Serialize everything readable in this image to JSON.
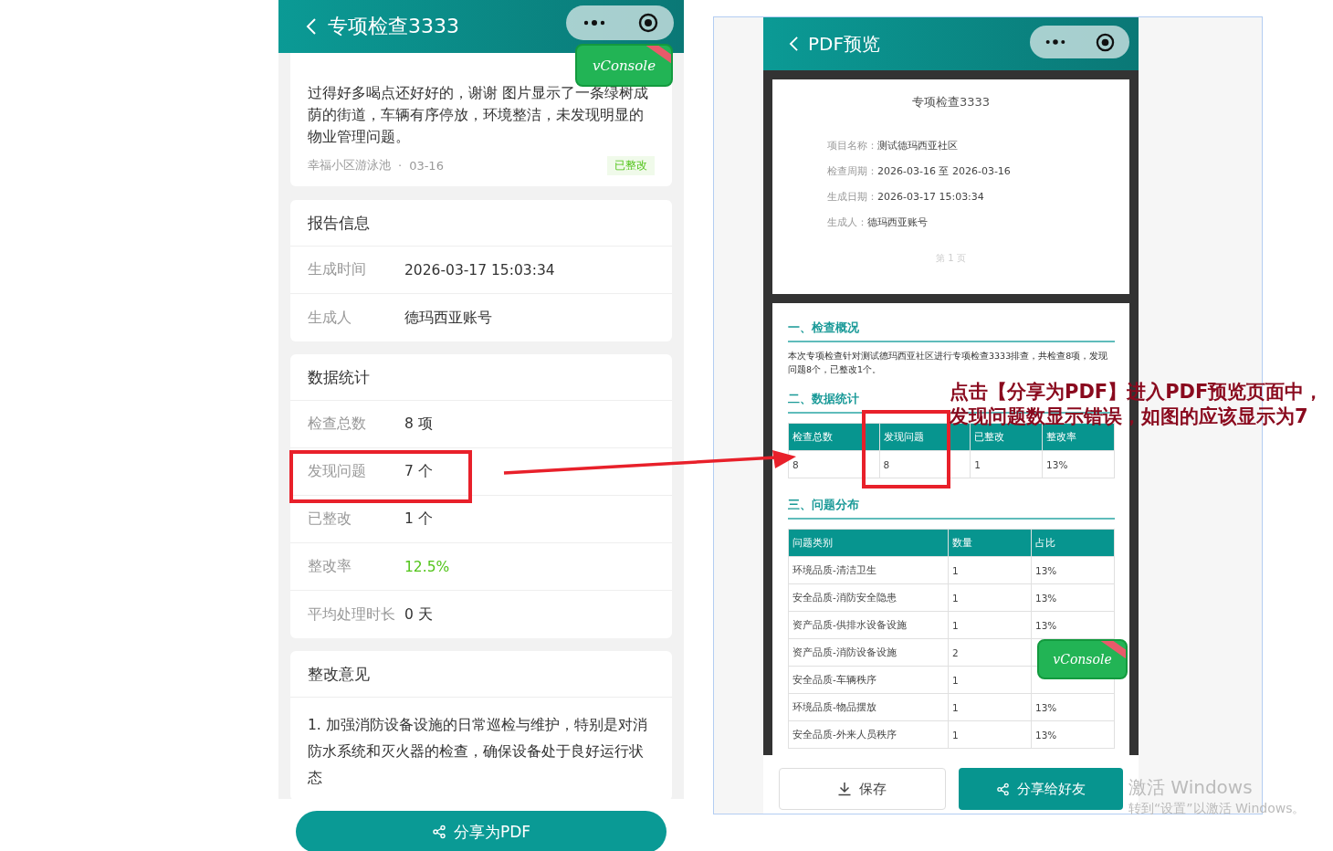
{
  "left_screen": {
    "title": "专项检查3333",
    "issue_card": {
      "description": "过得好多喝点还好好的，谢谢 图片显示了一条绿树成荫的街道，车辆有序停放，环境整洁，未发现明显的物业管理问题。",
      "location": "幸福小区游泳池",
      "separator": "·",
      "date": "03-16",
      "status": "已整改"
    },
    "report_info": {
      "title": "报告信息",
      "rows": [
        {
          "label": "生成时间",
          "value": "2026-03-17 15:03:34"
        },
        {
          "label": "生成人",
          "value": "德玛西亚账号"
        }
      ]
    },
    "stats": {
      "title": "数据统计",
      "rows": [
        {
          "label": "检查总数",
          "value": "8 项",
          "highlight": false
        },
        {
          "label": "发现问题",
          "value": "7 个",
          "highlight": false
        },
        {
          "label": "已整改",
          "value": "1 个",
          "highlight": false
        },
        {
          "label": "整改率",
          "value": "12.5%",
          "highlight": true
        },
        {
          "label": "平均处理时长",
          "value": "0 天",
          "highlight": false
        }
      ]
    },
    "opinion": {
      "title": "整改意见",
      "text": "1. 加强消防设备设施的日常巡检与维护，特别是对消防水系统和灭火器的检查，确保设备处于良好运行状态"
    },
    "share_button": "分享为PDF"
  },
  "right_screen": {
    "title": "PDF预览",
    "page1": {
      "subtitle": "专项检查3333",
      "fields": [
        {
          "label": "项目名称：",
          "value": "测试德玛西亚社区"
        },
        {
          "label": "检查周期：",
          "value": "2026-03-16 至 2026-03-16"
        },
        {
          "label": "生成日期：",
          "value": "2026-03-17 15:03:34"
        },
        {
          "label": "生成人：",
          "value": "德玛西亚账号"
        }
      ],
      "page_number": "第 1 页"
    },
    "overview": {
      "heading": "一、检查概况",
      "text": "本次专项检查针对测试德玛西亚社区进行专项检查3333排查，共检查8项，发现问题8个，已整改1个。"
    },
    "stats": {
      "heading": "二、数据统计",
      "columns": [
        "检查总数",
        "发现问题",
        "已整改",
        "整改率"
      ],
      "values": [
        "8",
        "8",
        "1",
        "13%"
      ]
    },
    "distribution": {
      "heading": "三、问题分布",
      "columns": [
        "问题类别",
        "数量",
        "占比"
      ],
      "rows": [
        {
          "category": "环境品质-清洁卫生",
          "count": "1",
          "share": "13%"
        },
        {
          "category": "安全品质-消防安全隐患",
          "count": "1",
          "share": "13%"
        },
        {
          "category": "资产品质-供排水设备设施",
          "count": "1",
          "share": "13%"
        },
        {
          "category": "资产品质-消防设备设施",
          "count": "2"
        },
        {
          "category": "安全品质-车辆秩序",
          "count": "1"
        },
        {
          "category": "环境品质-物品摆放",
          "count": "1",
          "share": "13%"
        },
        {
          "category": "安全品质-外来人员秩序",
          "count": "1",
          "share": "13%"
        }
      ]
    },
    "save_button": "保存",
    "share_button": "分享给好友"
  },
  "vconsole_buttons": [
    "vConsole",
    "vConsole"
  ],
  "annotation": {
    "lines": [
      "点击【分享为PDF】进入PDF预览页面中，",
      "发现问题数显示错误，如图的应该显示为7"
    ]
  },
  "os_notice": {
    "title": "激活 Windows",
    "hint": "转到“设置”以激活 Windows。"
  }
}
